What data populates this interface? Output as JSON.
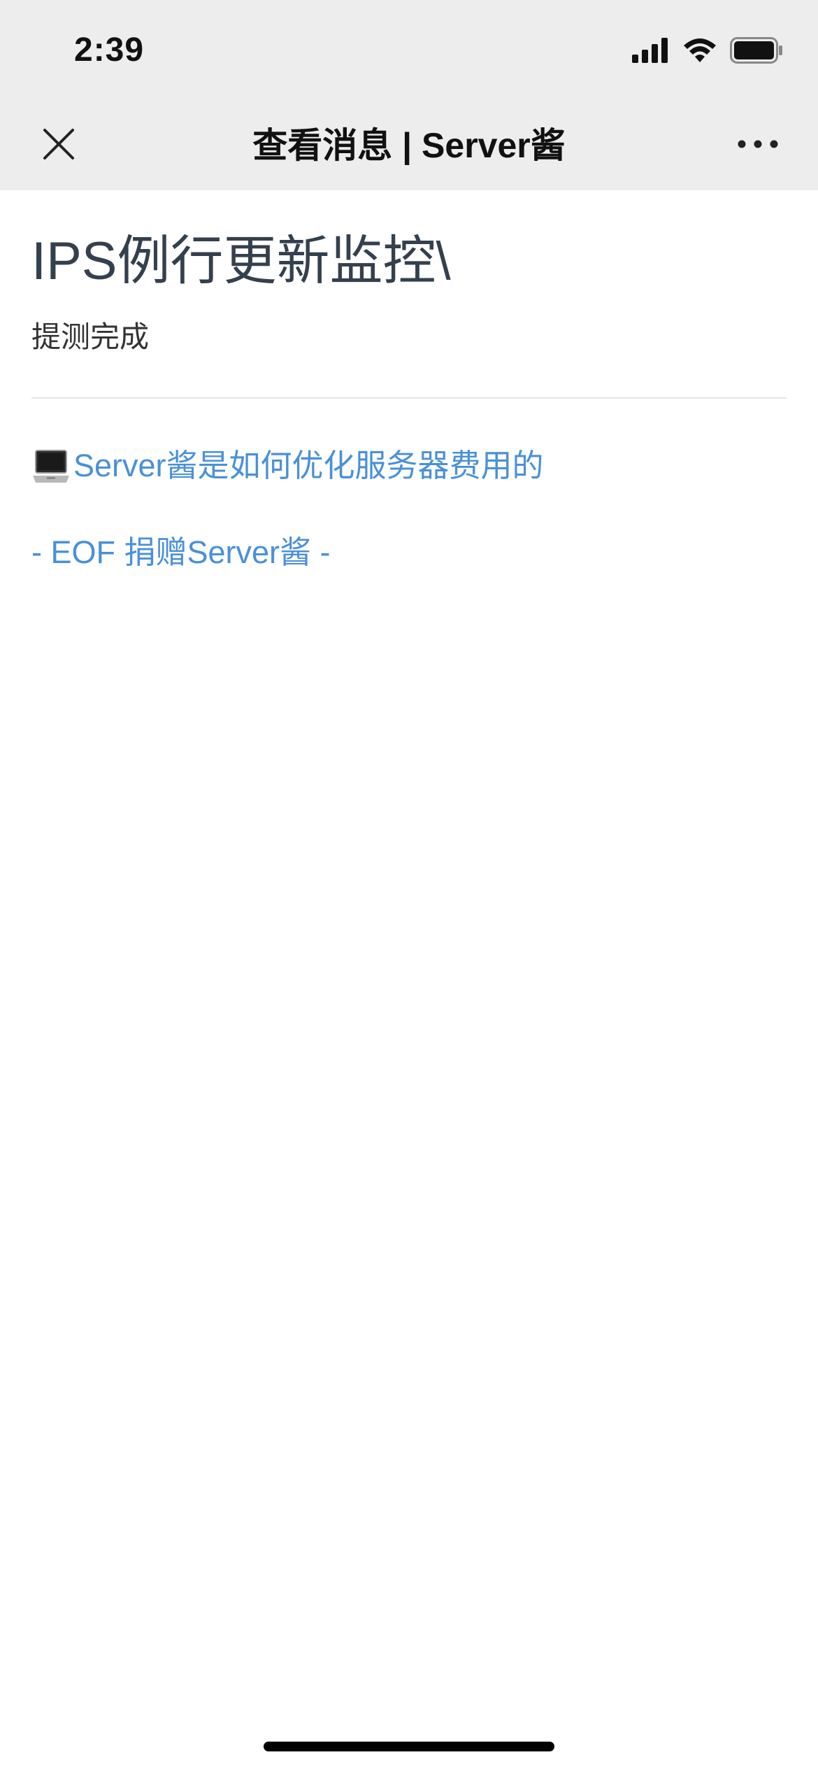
{
  "status_bar": {
    "time": "2:39"
  },
  "nav": {
    "title": "查看消息 | Server酱",
    "close_icon": "close-icon",
    "more_icon": "more-horizontal-icon"
  },
  "message": {
    "title": "IPS例行更新监控\\",
    "description": "提测完成",
    "promo_link_text": "Server酱是如何优化服务器费用的",
    "promo_icon": "laptop-icon",
    "eof_link_text": "- EOF 捐赠Server酱 -"
  },
  "colors": {
    "header_bg": "#ededed",
    "link": "#4a90d9",
    "title_text": "#34404d"
  }
}
